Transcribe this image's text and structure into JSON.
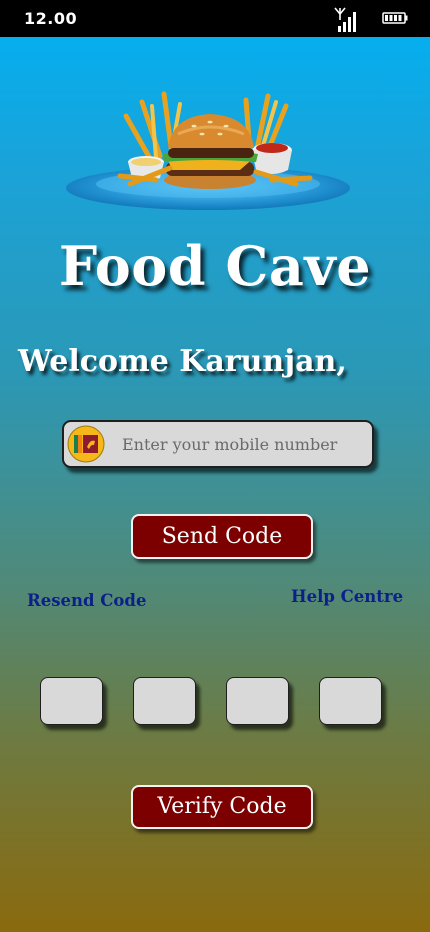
{
  "status_bar": {
    "time": "12.00",
    "icons": [
      "signal-icon",
      "battery-icon"
    ]
  },
  "hero": {
    "image": "burger-and-fries-platter"
  },
  "app": {
    "title": "Food Cave"
  },
  "welcome": {
    "text": "Welcome Karunjan,"
  },
  "phone": {
    "country_flag": "sri-lanka-flag-icon",
    "placeholder": "Enter your mobile number",
    "value": ""
  },
  "buttons": {
    "send_code": "Send Code",
    "verify_code": "Verify Code"
  },
  "links": {
    "resend_code": "Resend Code",
    "help_centre": "Help Centre"
  },
  "otp": {
    "digits": [
      "",
      "",
      "",
      ""
    ]
  },
  "colors": {
    "gradient_top": "#00b1f5",
    "gradient_bottom": "#8a6a0e",
    "button": "#7d0000",
    "link": "#0d1f8a",
    "field": "#d9d9d9"
  }
}
